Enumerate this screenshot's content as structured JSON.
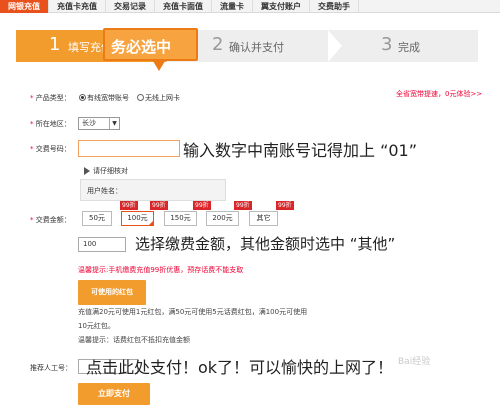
{
  "topnav": {
    "tabs": [
      "网银充值",
      "充值卡充值",
      "交易记录",
      "充值卡面值",
      "流量卡",
      "翼支付账户",
      "交费助手"
    ]
  },
  "steps": {
    "step1": {
      "num": "1",
      "label": "填写充值"
    },
    "step2": {
      "num": "2",
      "label": "确认并支付"
    },
    "step3": {
      "num": "3",
      "label": "完成"
    }
  },
  "callout": "务必选中",
  "form": {
    "product_type": {
      "label": "产品类型：",
      "options": [
        "有线宽带账号",
        "无线上网卡"
      ],
      "selected": "有线宽带账号"
    },
    "promo_link": "全省宽带提速，0元体验>>",
    "region": {
      "label": "所在地区：",
      "value": "长沙",
      "caret": "▼"
    },
    "account": {
      "label": "交费号码：",
      "value": ""
    },
    "account_hint": "输入数字中南账号记得加上 “01”",
    "detail_toggle": "请仔细核对",
    "user_name_label": "用户姓名：",
    "amount": {
      "label": "交费金额：",
      "options": [
        "50元",
        "100元",
        "150元",
        "200元",
        "其它"
      ],
      "selected": "100元",
      "badges": [
        "99折",
        "99折",
        "99折",
        "99折",
        "99折"
      ],
      "custom_value": "100"
    },
    "amount_hint": "选择缴费金额，其他金额时选中 “其他”",
    "notice": "温馨提示:手机缴费充值99折优惠，预存话费不能支取",
    "coupon_button": "可使用的红包",
    "coupon_rule_1": "充值满20元可使用1元红包，满50元可使用5元话费红包，满100元可使用",
    "coupon_rule_2": "10元红包。",
    "coupon_tip": "温馨提示：话费红包不抵扣充值金额",
    "referrer_label": "推荐人工号：",
    "pay_hint": "点击此处支付！ok了！可以愉快的上网了！",
    "pay_button": "立即支付"
  },
  "watermark": "Bai经验"
}
